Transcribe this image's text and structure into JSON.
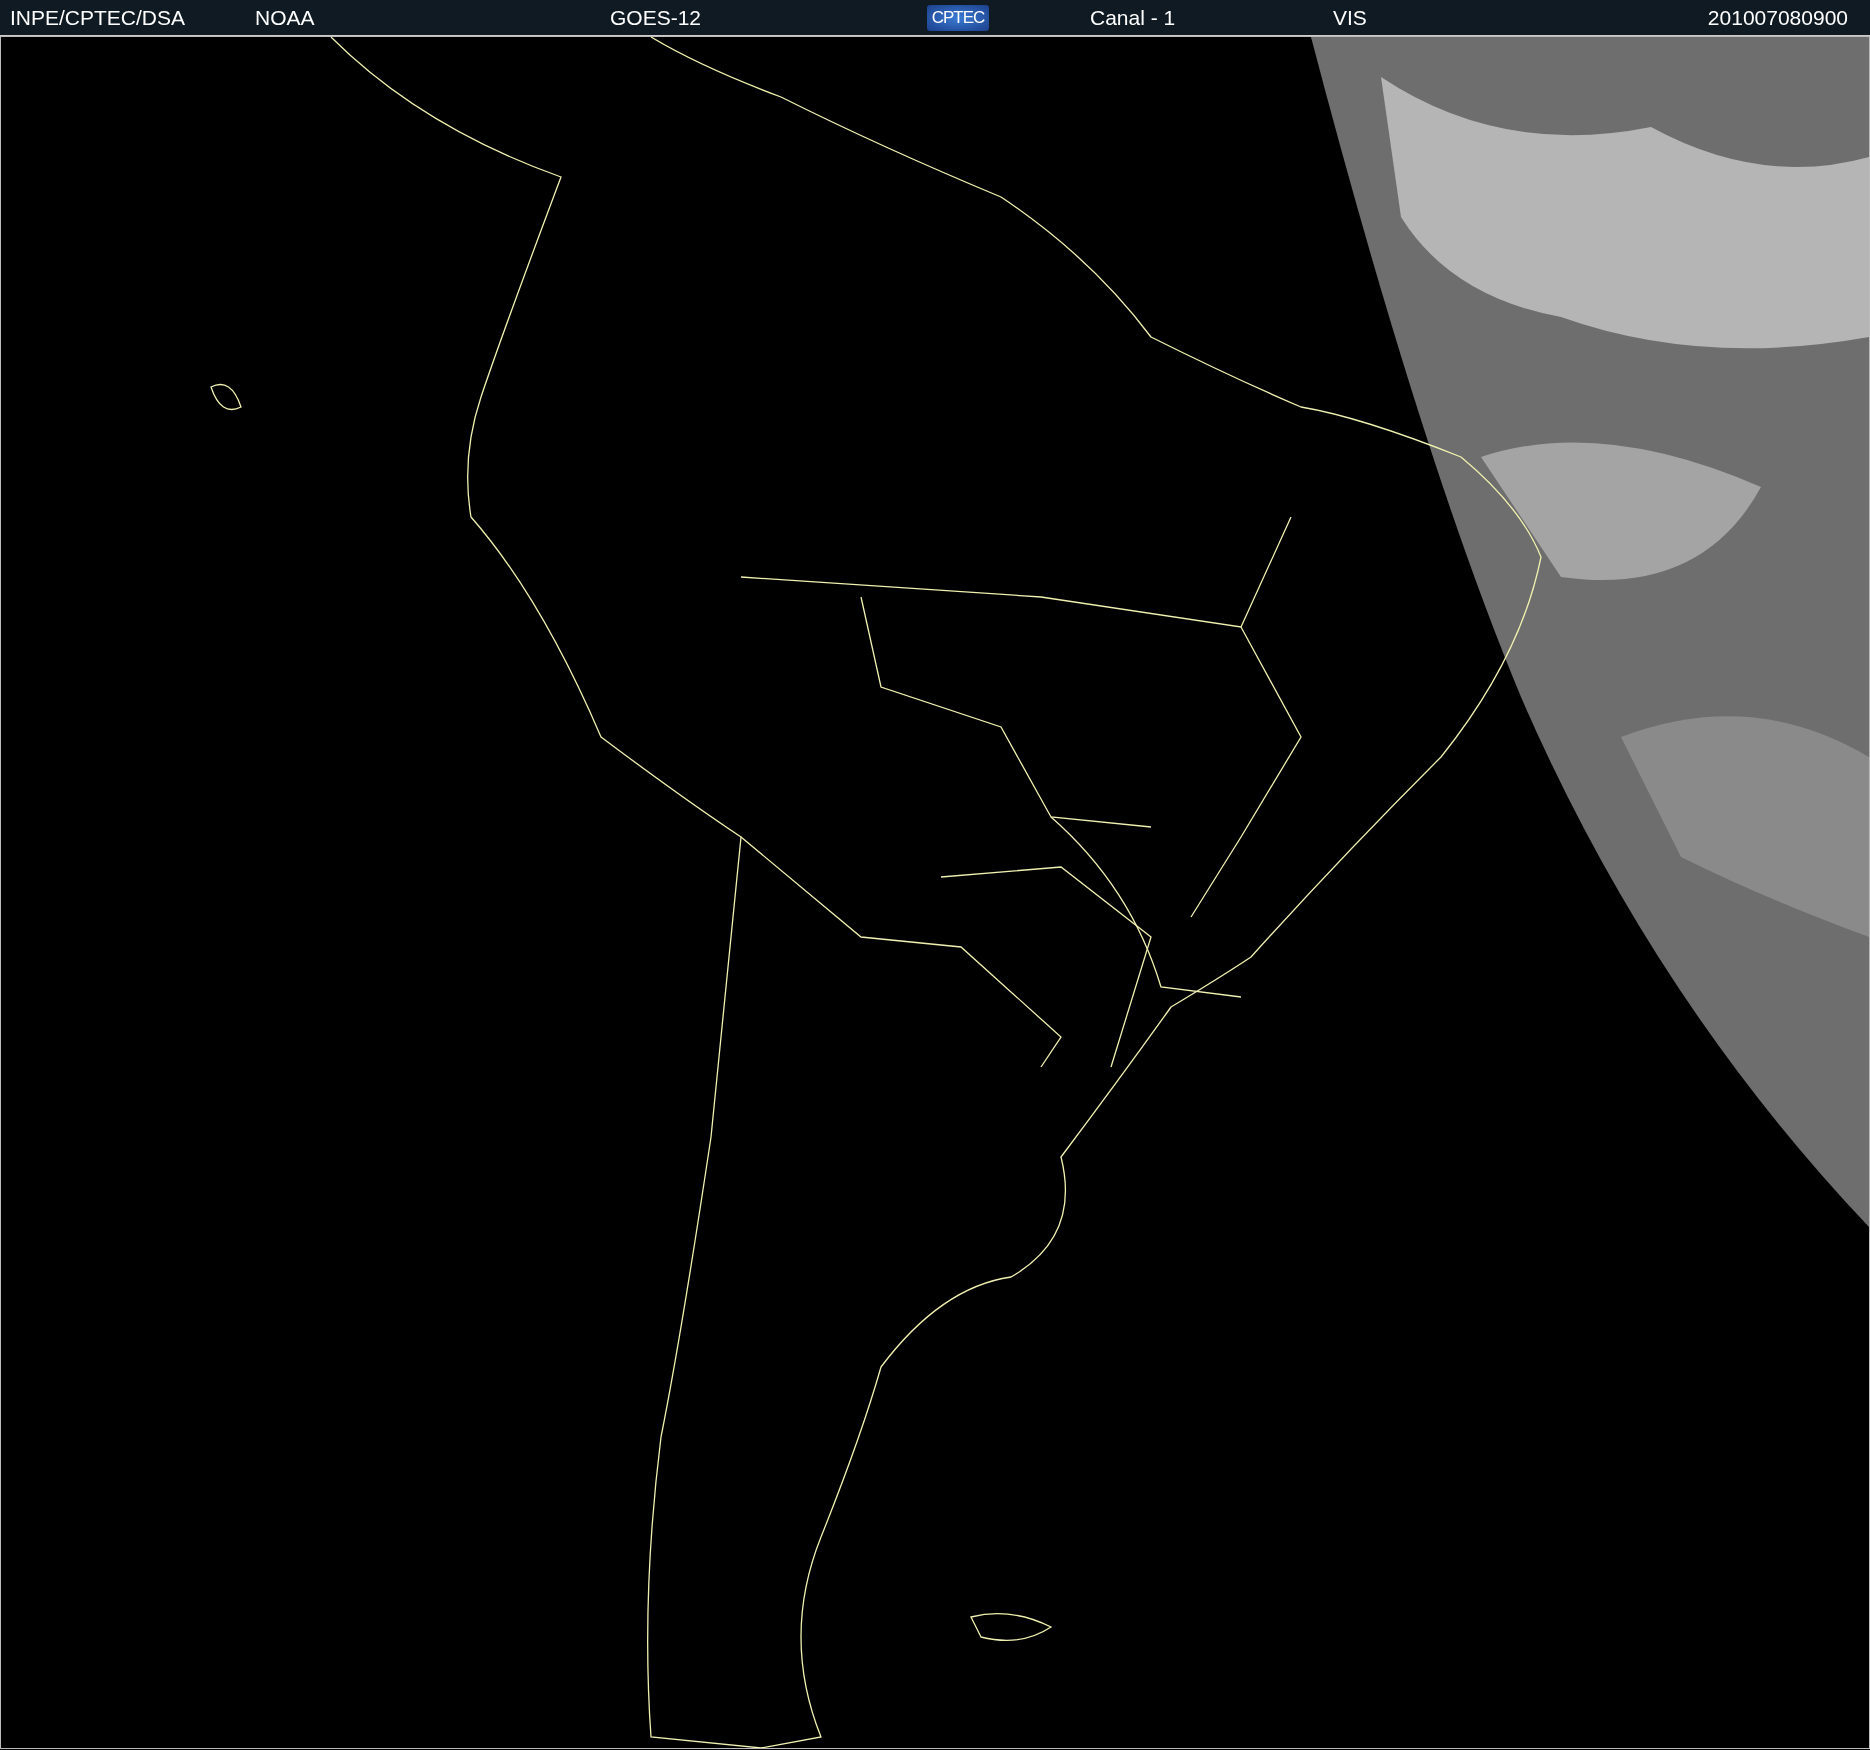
{
  "header": {
    "source": "INPE/CPTEC/DSA",
    "agency": "NOAA",
    "satellite": "GOES-12",
    "logo": "CPTEC",
    "channel": "Canal - 1",
    "band": "VIS",
    "timestamp": "201007080900"
  }
}
